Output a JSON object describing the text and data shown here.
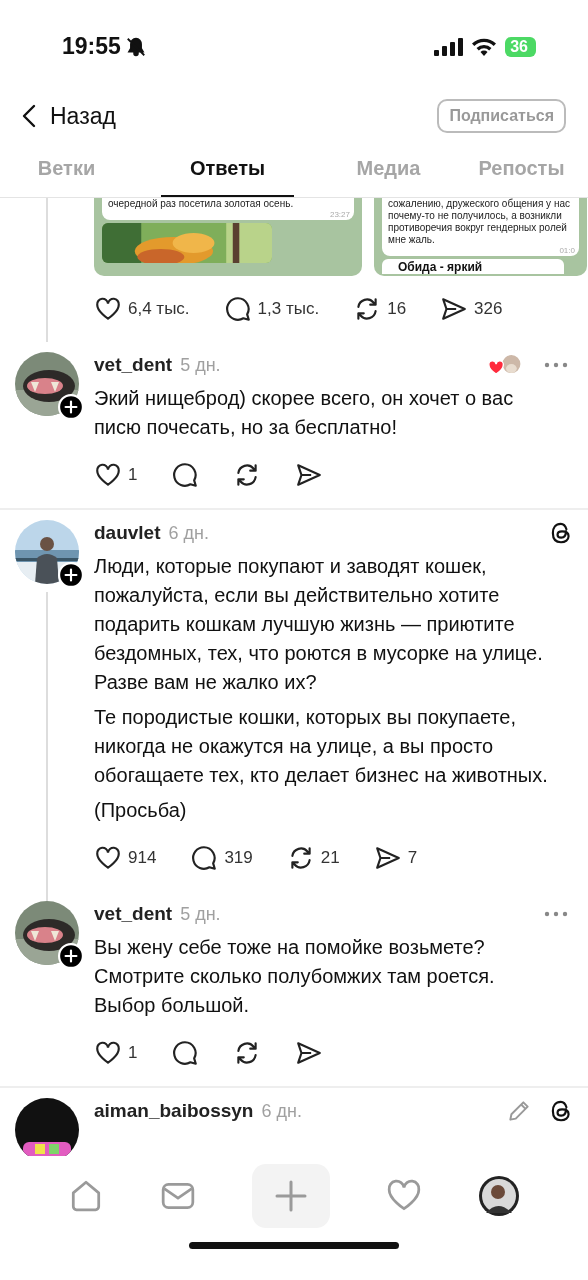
{
  "status_bar": {
    "time": "19:55",
    "battery": "36"
  },
  "header": {
    "back": "Назад",
    "follow_button": "Подписаться"
  },
  "tabs": [
    {
      "label": "Ветки",
      "selected": false
    },
    {
      "label": "Ответы",
      "selected": true
    },
    {
      "label": "Медиа",
      "selected": false
    },
    {
      "label": "Репосты",
      "selected": false
    }
  ],
  "posts": [
    {
      "kind": "media",
      "thread_line": true,
      "media": [
        {
          "lines": [
            "очередной раз посетила золотая осень."
          ],
          "time": "23:27",
          "photo": true
        },
        {
          "lines": [
            "сожалению, дружеского общения у нас",
            "почему-то не получилось, а возникли",
            "противоречия вокруг гендерных ролей",
            "мне жаль."
          ],
          "time": "01:0",
          "quote": "Обида - яркий"
        }
      ],
      "actions": [
        {
          "kind": "like",
          "count": "6,4 тыс."
        },
        {
          "kind": "reply",
          "count": "1,3 тыс."
        },
        {
          "kind": "repost",
          "count": "16"
        },
        {
          "kind": "share",
          "count": "326"
        }
      ]
    },
    {
      "kind": "text",
      "user": "vet_dent",
      "time": "5 дн.",
      "liked_by_author": true,
      "more": true,
      "paragraphs": [
        "Экий нищеброд) скорее всего, он хочет о вас писю почесать, но за бесплатно!"
      ],
      "actions": [
        {
          "kind": "like",
          "count": "1"
        },
        {
          "kind": "reply"
        },
        {
          "kind": "repost"
        },
        {
          "kind": "share"
        }
      ],
      "divider": true
    },
    {
      "kind": "text",
      "thread_line": true,
      "user": "dauvlet",
      "time": "6 дн.",
      "threads_badge": true,
      "paragraphs": [
        "Люди, которые покупают и заводят кошек, пожалуйста, если вы действительно хотите подарить кошкам лучшую жизнь — приютите бездомных, тех, что роются в мусорке на улице. Разве вам не жалко их?",
        "Те породистые кошки, которых вы покупаете, никогда не окажутся на улице, а вы просто обогащаете тех, кто делает бизнес на животных.",
        "(Просьба)"
      ],
      "actions": [
        {
          "kind": "like",
          "count": "914"
        },
        {
          "kind": "reply",
          "count": "319"
        },
        {
          "kind": "repost",
          "count": "21"
        },
        {
          "kind": "share",
          "count": "7"
        }
      ]
    },
    {
      "kind": "text",
      "user": "vet_dent",
      "time": "5 дн.",
      "more": true,
      "paragraphs": [
        "Вы жену себе тоже на помойке возьмете? Смотрите сколько полубомжих там роется. Выбор большой."
      ],
      "actions": [
        {
          "kind": "like",
          "count": "1"
        },
        {
          "kind": "reply"
        },
        {
          "kind": "repost"
        },
        {
          "kind": "share"
        }
      ],
      "divider": true
    },
    {
      "kind": "text",
      "user": "aiman_baibossyn",
      "time": "6 дн.",
      "threads_badge": true,
      "edit": true
    }
  ],
  "nav": [
    {
      "kind": "home"
    },
    {
      "kind": "inbox"
    },
    {
      "kind": "create"
    },
    {
      "kind": "activity"
    },
    {
      "kind": "profile"
    }
  ]
}
